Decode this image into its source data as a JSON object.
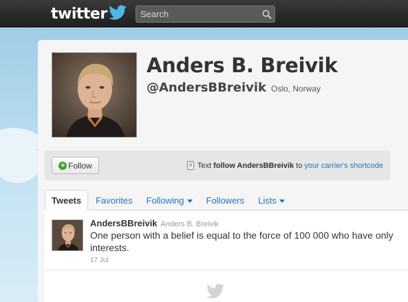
{
  "header": {
    "logo_text": "twitter",
    "search": {
      "placeholder": "Search"
    }
  },
  "profile": {
    "name": "Anders B. Breivik",
    "handle": "@AndersBBreivik",
    "location": "Oslo, Norway"
  },
  "follow_bar": {
    "follow_label": "Follow",
    "sms_prefix": "Text",
    "sms_follow": "follow AndersBBreivik",
    "sms_to": "to",
    "sms_link": "your carrier's shortcode"
  },
  "tabs": [
    {
      "label": "Tweets",
      "active": true
    },
    {
      "label": "Favorites"
    },
    {
      "label": "Following",
      "dropdown": true
    },
    {
      "label": "Followers"
    },
    {
      "label": "Lists",
      "dropdown": true
    }
  ],
  "tweets": [
    {
      "username": "AndersBBreivik",
      "fullname": "Anders B. Breivik",
      "text": "One person with a belief is equal to the force of 100 000 who have only interests.",
      "date": "17 Jul"
    }
  ],
  "colors": {
    "link": "#2276bb",
    "background": "#c0deed",
    "topbar": "#1f1f1f",
    "follow_icon": "#3ea32b"
  },
  "icons": {
    "search": "search-icon",
    "bird": "twitter-bird-icon",
    "phone": "phone-icon",
    "plus": "plus-icon"
  }
}
